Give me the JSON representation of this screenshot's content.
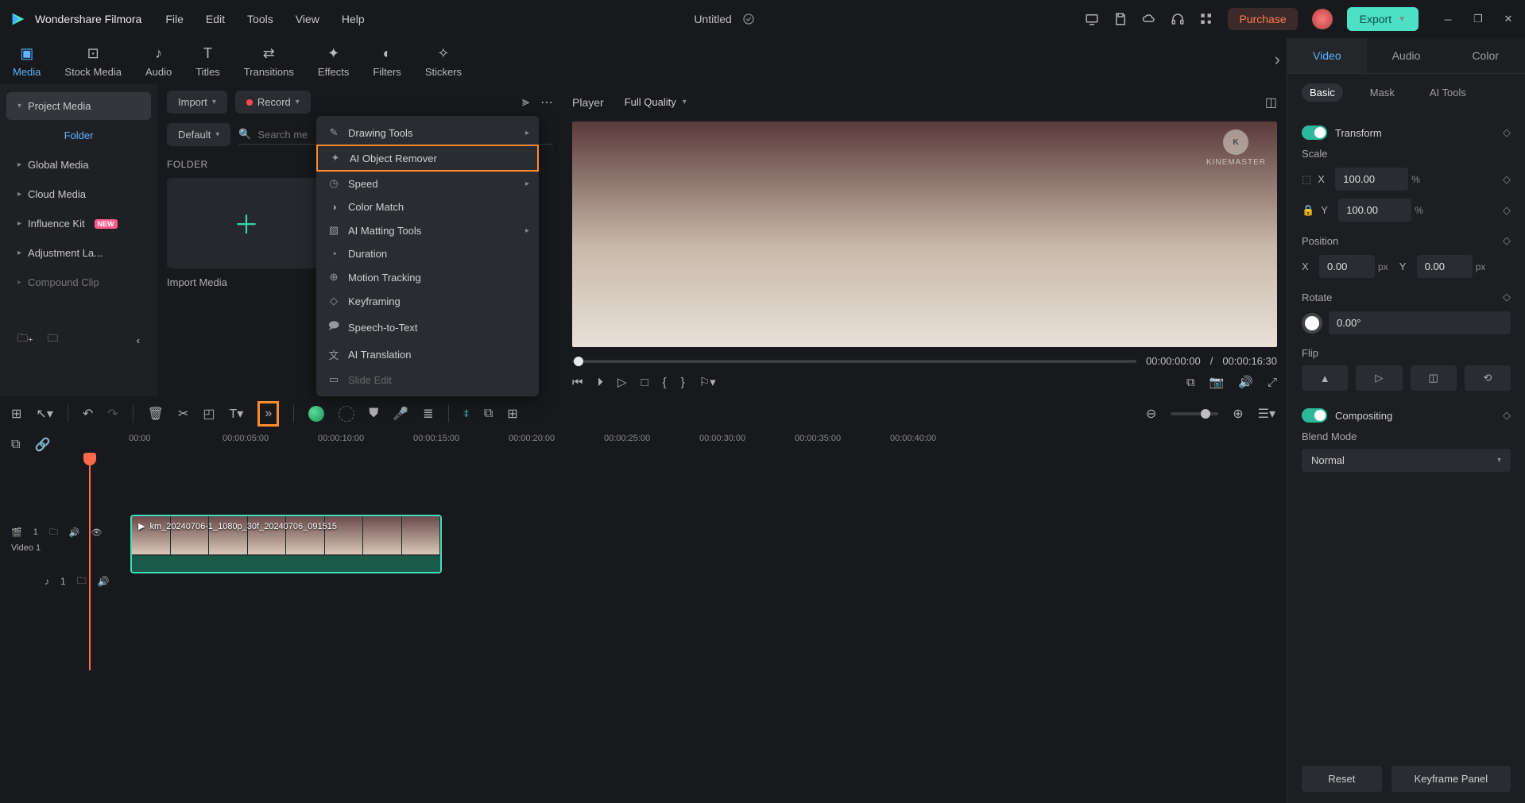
{
  "app_name": "Wondershare Filmora",
  "menubar": [
    "File",
    "Edit",
    "Tools",
    "View",
    "Help"
  ],
  "document_title": "Untitled",
  "purchase_label": "Purchase",
  "export_label": "Export",
  "ribbon": [
    {
      "label": "Media",
      "icon": "media-icon"
    },
    {
      "label": "Stock Media",
      "icon": "stock-icon"
    },
    {
      "label": "Audio",
      "icon": "audio-icon"
    },
    {
      "label": "Titles",
      "icon": "titles-icon"
    },
    {
      "label": "Transitions",
      "icon": "transitions-icon"
    },
    {
      "label": "Effects",
      "icon": "effects-icon"
    },
    {
      "label": "Filters",
      "icon": "filters-icon"
    },
    {
      "label": "Stickers",
      "icon": "stickers-icon"
    }
  ],
  "sidebar": {
    "items": [
      {
        "label": "Project Media"
      },
      {
        "label": "Folder"
      },
      {
        "label": "Global Media"
      },
      {
        "label": "Cloud Media"
      },
      {
        "label": "Influence Kit",
        "badge": "NEW"
      },
      {
        "label": "Adjustment La..."
      },
      {
        "label": "Compound Clip"
      }
    ]
  },
  "mid": {
    "import": "Import",
    "record": "Record",
    "default": "Default",
    "search_placeholder": "Search me",
    "folder_header": "FOLDER",
    "import_media": "Import Media"
  },
  "context_menu": [
    {
      "label": "Drawing Tools",
      "icon": "pencil-icon",
      "submenu": true
    },
    {
      "label": "AI Object Remover",
      "icon": "wand-icon",
      "highlighted": true
    },
    {
      "label": "Speed",
      "icon": "gauge-icon",
      "submenu": true
    },
    {
      "label": "Color Match",
      "icon": "palette-icon"
    },
    {
      "label": "AI Matting Tools",
      "icon": "matting-icon",
      "submenu": true
    },
    {
      "label": "Duration",
      "icon": "clock-icon"
    },
    {
      "label": "Motion Tracking",
      "icon": "target-icon"
    },
    {
      "label": "Keyframing",
      "icon": "diamond-icon"
    },
    {
      "label": "Speech-to-Text",
      "icon": "speech-icon"
    },
    {
      "label": "AI Translation",
      "icon": "translate-icon"
    },
    {
      "label": "Slide Edit",
      "icon": "slide-icon",
      "disabled": true
    }
  ],
  "preview": {
    "player_label": "Player",
    "quality": "Full Quality",
    "watermark": "KINEMASTER",
    "current_time": "00:00:00:00",
    "duration": "00:00:16:30"
  },
  "props": {
    "tabs": [
      "Video",
      "Audio",
      "Color"
    ],
    "subtabs": [
      "Basic",
      "Mask",
      "AI Tools"
    ],
    "transform_label": "Transform",
    "scale_label": "Scale",
    "scale_x": "100.00",
    "scale_y": "100.00",
    "position_label": "Position",
    "pos_x": "0.00",
    "pos_y": "0.00",
    "rotate_label": "Rotate",
    "rotate_val": "0.00°",
    "flip_label": "Flip",
    "compositing_label": "Compositing",
    "blend_label": "Blend Mode",
    "blend_value": "Normal",
    "reset": "Reset",
    "keyframe": "Keyframe Panel",
    "unit_pct": "%",
    "unit_px": "px",
    "axis_x": "X",
    "axis_y": "Y"
  },
  "timeline": {
    "ticks": [
      "00:00",
      "00:00:05:00",
      "00:00:10:00",
      "00:00:15:00",
      "00:00:20:00",
      "00:00:25:00",
      "00:00:30:00",
      "00:00:35:00",
      "00:00:40:00"
    ],
    "video_track_label": "Video 1",
    "video_track_num": "1",
    "audio_track_num": "1",
    "clip_name": "km_20240706-1_1080p_30f_20240706_091515"
  }
}
